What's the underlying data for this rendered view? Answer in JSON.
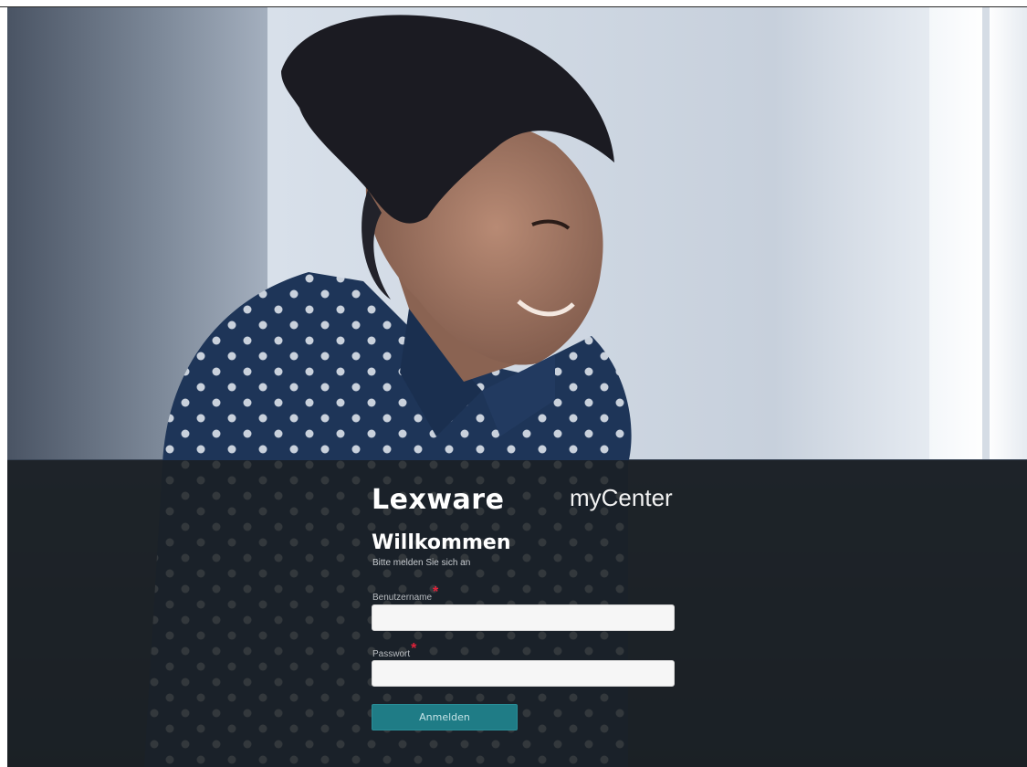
{
  "brand": {
    "logo_text": "Lexware",
    "app_name": "myCenter"
  },
  "login": {
    "title": "Willkommen",
    "subtitle": "Bitte melden Sie sich an",
    "username_label": "Benutzername",
    "password_label": "Passwort",
    "required_marker": "*",
    "username_value": "",
    "password_value": "",
    "submit_label": "Anmelden"
  },
  "colors": {
    "overlay": "#1a1e22",
    "button": "#1f7c86",
    "required": "#e0223a"
  }
}
